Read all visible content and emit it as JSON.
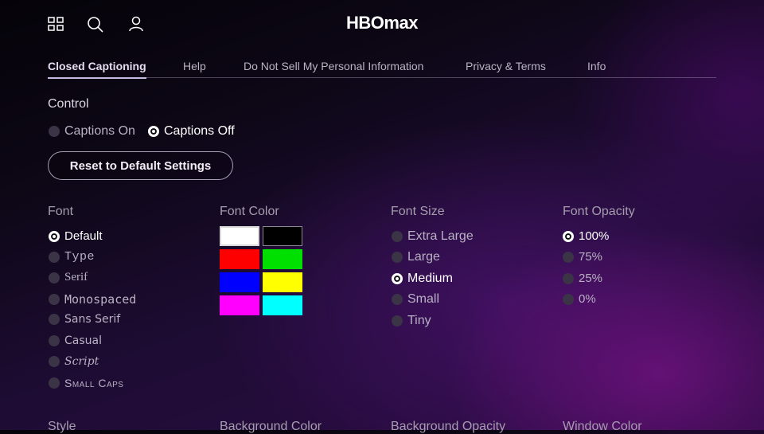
{
  "app": {
    "logo": "HBOmax"
  },
  "tabs": [
    {
      "label": "Closed Captioning"
    },
    {
      "label": "Help"
    },
    {
      "label": "Do Not Sell My Personal Information"
    },
    {
      "label": "Privacy & Terms"
    },
    {
      "label": "Info"
    }
  ],
  "control": {
    "title": "Control",
    "options": [
      {
        "label": "Captions On",
        "selected": false
      },
      {
        "label": "Captions Off",
        "selected": true
      }
    ],
    "reset_label": "Reset to Default Settings"
  },
  "font": {
    "title": "Font",
    "options": [
      "Default",
      "Type",
      "Serif",
      "Monospaced",
      "Sans Serif",
      "Casual",
      "Script",
      "Small Caps"
    ],
    "selected": "Default"
  },
  "font_color": {
    "title": "Font Color",
    "colors": [
      "#ffffff",
      "#000000",
      "#ff0000",
      "#00e000",
      "#0000ff",
      "#ffff00",
      "#ff00ff",
      "#00ffff"
    ],
    "selected": "#ffffff"
  },
  "font_size": {
    "title": "Font Size",
    "options": [
      "Extra Large",
      "Large",
      "Medium",
      "Small",
      "Tiny"
    ],
    "selected": "Medium"
  },
  "font_opacity": {
    "title": "Font Opacity",
    "options": [
      "100%",
      "75%",
      "25%",
      "0%"
    ],
    "selected": "100%"
  },
  "bottom_sections": [
    "Style",
    "Background Color",
    "Background Opacity",
    "Window Color"
  ],
  "icons": {
    "browse": "grid-icon",
    "search": "search-icon",
    "profile": "profile-icon",
    "radio": "radio-icon"
  }
}
